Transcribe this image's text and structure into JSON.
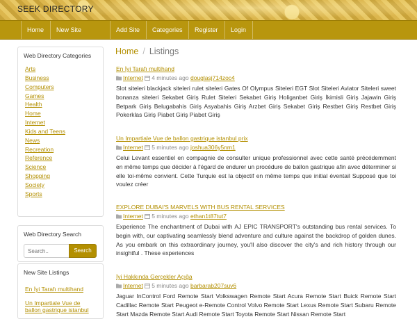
{
  "site": {
    "title": "SEEK DIRECTORY"
  },
  "nav": [
    "Home",
    "New Site Listings",
    "Add Site",
    "Categories",
    "Register",
    "Login"
  ],
  "sidebar": {
    "categories_title": "Web Directory Categories",
    "categories": [
      "Arts",
      "Business",
      "Computers",
      "Games",
      "Health",
      "Home",
      "Internet",
      "Kids and Teens",
      "News",
      "Recreation",
      "Reference",
      "Science",
      "Shopping",
      "Society",
      "Sports"
    ],
    "search_title": "Web Directory Search",
    "search_placeholder": "Search..",
    "search_button": "Search",
    "new_listings_title": "New Site Listings",
    "new_listings": [
      "En İyi Tarafı multihand",
      "Un Impartiale Vue de ballon gastrique istanbul"
    ]
  },
  "breadcrumb": {
    "home": "Home",
    "current": "Listings"
  },
  "listings": [
    {
      "title": "En İyi Tarafı multihand",
      "category": "Internet",
      "time": "4 minutes ago",
      "user": "douglasj714zoc4",
      "description": "Slot siteleri blackjack siteleri rulet siteleri Gates Of Olympus Siteleri EGT Slot Siteleri Aviator Siteleri sweet bonanza siteleri Sekabet Giriş Rulet Siteleri Sekabet Giriş Holiganbet Giriş İkimisli Giriş Jajawin Giriş Betpark Giriş Belugabahis Giriş Asyabahis Giriş Arzbet Giriş Sekabet Giriş Restbet Giriş Restbet Giriş Pokerklas Giriş Piabet Giriş Piabet Giriş"
    },
    {
      "title": "Un Impartiale Vue de ballon gastrique istanbul prix",
      "category": "Internet",
      "time": "5 minutes ago",
      "user": "joshua306y5nm1",
      "description": "Celui Levant essentiel en compagnie de consulter unique professionnel avec cette santé précédemment en même temps que décider à l'égard de endurer un procédure de ballon gastrique afin avec déterminer si elle toi-même convient. Cette Turquie est la objectif en même temps que initial éventail Supposé que toi voulez créer"
    },
    {
      "title": "EXPLORE DUBAI'S MARVELS WITH BUS RENTAL SERVICES",
      "category": "Internet",
      "time": "5 minutes ago",
      "user": "ethan1t87tut7",
      "description": "Experience The enchantment of Dubai with AJ EPIC TRANSPORT's outstanding bus rental services. To begin with, our captivating seamlessly blend adventure and culture against the backdrop of golden dunes. As you embark on this extraordinary journey, you'll also discover the city's and rich history through our insightful . These experiences"
    },
    {
      "title": "İyi Hakkında Gerçekler Açığa",
      "category": "Internet",
      "time": "5 minutes ago",
      "user": "barbarab207suv6",
      "description": "Jaguar InControl Ford Remote Start Volkswagen Remote Start Acura Remote Start Buick Remote Start Cadillac Remote Start Peugeot e-Remote Control Volvo Remote Start Lexus Remote Start Subaru Remote Start Mazda Remote Start Audi Remote Start Toyota Remote Start Nissan Remote Start"
    }
  ],
  "colors": {
    "accent": "#b38f00",
    "navbar": "#b8960e"
  }
}
